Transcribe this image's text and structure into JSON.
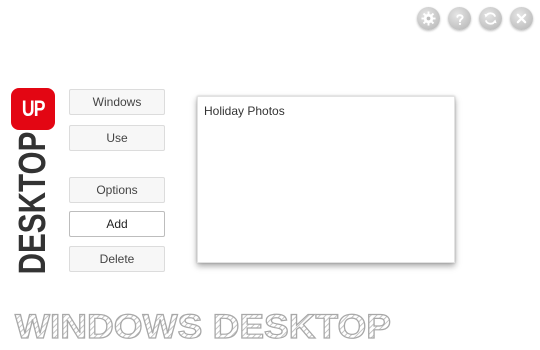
{
  "toolbar": {
    "icons": [
      "gear-icon",
      "help-icon",
      "refresh-icon",
      "close-icon"
    ]
  },
  "logo": {
    "badge_text": "UP",
    "word": "DESKTOP"
  },
  "buttons": {
    "windows": "Windows",
    "use": "Use",
    "options": "Options",
    "add": "Add",
    "delete": "Delete"
  },
  "panel": {
    "item": "Holiday Photos"
  },
  "footer": {
    "title": "WINDOWS DESKTOP"
  },
  "colors": {
    "accent": "#e30613",
    "logo_text": "#333333",
    "button_bg": "#f7f7f7",
    "button_border": "#dcdcdc",
    "footer_stroke": "#a8a8a8"
  }
}
